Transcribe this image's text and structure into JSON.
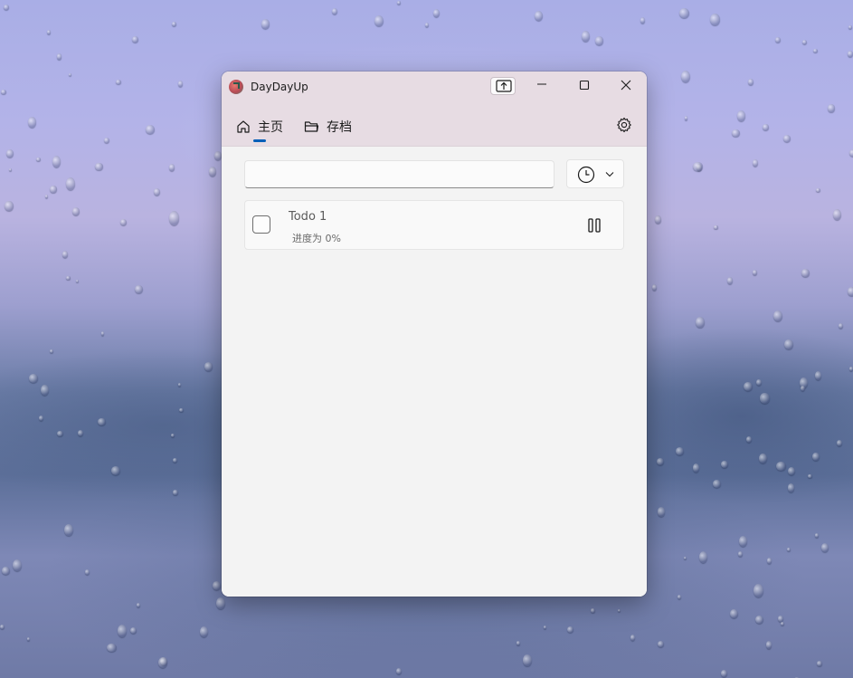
{
  "window": {
    "title": "DayDayUp"
  },
  "nav": {
    "tabs": [
      {
        "label": "主页",
        "icon": "home-icon",
        "selected": true
      },
      {
        "label": "存档",
        "icon": "folder-icon",
        "selected": false
      }
    ],
    "settings_icon": "gear-icon"
  },
  "toolbar": {
    "search_value": "",
    "sort_icon": "clock-icon"
  },
  "todos": [
    {
      "title": "Todo 1",
      "progress_text": "进度为 0%",
      "progress": 0,
      "checked": false,
      "action_icon": "pause-icon"
    }
  ],
  "colors": {
    "accent": "#005fb8",
    "titlebar": "#e7dce3",
    "content_bg": "#f3f3f3"
  }
}
